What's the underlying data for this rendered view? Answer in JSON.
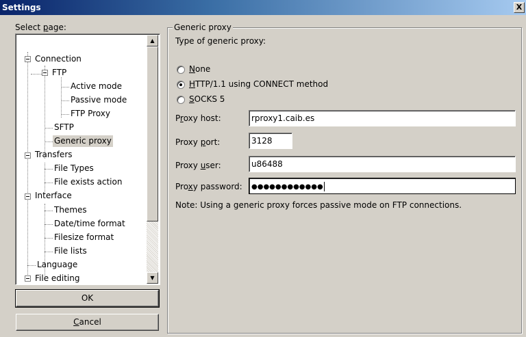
{
  "window": {
    "title": "Settings",
    "close_glyph": "X"
  },
  "page_selector": {
    "label_prefix": "Select ",
    "label_accel": "p",
    "label_suffix": "age:",
    "tree": [
      {
        "label": "Connection"
      },
      {
        "label": "FTP"
      },
      {
        "label": "Active mode"
      },
      {
        "label": "Passive mode"
      },
      {
        "label": "FTP Proxy"
      },
      {
        "label": "SFTP"
      },
      {
        "label": "Generic proxy",
        "selected": true
      },
      {
        "label": "Transfers"
      },
      {
        "label": "File Types"
      },
      {
        "label": "File exists action"
      },
      {
        "label": "Interface"
      },
      {
        "label": "Themes"
      },
      {
        "label": "Date/time format"
      },
      {
        "label": "Filesize format"
      },
      {
        "label": "File lists"
      },
      {
        "label": "Language"
      },
      {
        "label": "File editing"
      }
    ],
    "scroll_up_glyph": "▲",
    "scroll_down_glyph": "▼"
  },
  "buttons": {
    "ok": "OK",
    "cancel_accel": "C",
    "cancel_rest": "ancel"
  },
  "generic_proxy": {
    "group_title": "Generic proxy",
    "type_label": "Type of generic proxy:",
    "options": [
      {
        "accel": "N",
        "rest": "one",
        "checked": false
      },
      {
        "accel": "H",
        "rest": "TTP/1.1 using CONNECT method",
        "checked": true
      },
      {
        "accel": "S",
        "rest": "OCKS 5",
        "checked": false
      }
    ],
    "host": {
      "label_pre": "P",
      "label_accel": "r",
      "label_post": "oxy host:",
      "value": "rproxy1.caib.es"
    },
    "port": {
      "label_pre": "Proxy ",
      "label_accel": "p",
      "label_post": "ort:",
      "value": "3128"
    },
    "user": {
      "label_pre": "Proxy ",
      "label_accel": "u",
      "label_post": "ser:",
      "value": "u86488"
    },
    "password": {
      "label_pre": "Pro",
      "label_accel": "x",
      "label_post": "y password:",
      "value": "●●●●●●●●●●●●"
    },
    "note": "Note: Using a generic proxy forces passive mode on FTP connections."
  }
}
